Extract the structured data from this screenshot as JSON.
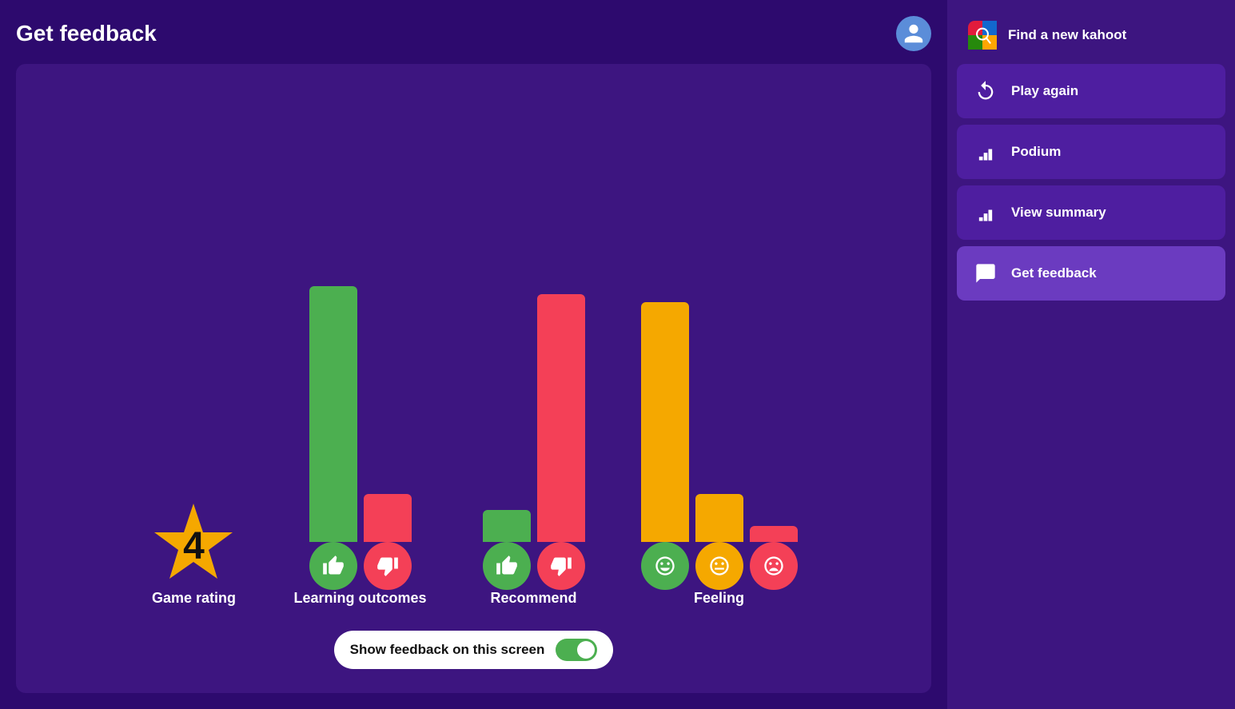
{
  "page": {
    "title": "Get feedback",
    "avatar_label": "user avatar"
  },
  "chart": {
    "game_rating": {
      "value": "4",
      "label": "Game rating"
    },
    "learning_outcomes": {
      "label": "Learning outcomes",
      "bar_height_yes": 320,
      "bar_height_no": 60,
      "bar_color_yes": "#4caf50",
      "bar_color_no": "#f44057"
    },
    "recommend": {
      "label": "Recommend",
      "bar_height_yes": 40,
      "bar_height_no": 310,
      "bar_color_yes": "#4caf50",
      "bar_color_no": "#f44057"
    },
    "feeling": {
      "label": "Feeling",
      "bar_height_happy": 300,
      "bar_height_neutral": 60,
      "bar_height_sad": 20,
      "bar_color_happy": "#f5a800",
      "bar_color_neutral": "#f5a800",
      "bar_color_sad": "#f44057"
    }
  },
  "toggle": {
    "label": "Show feedback on this screen",
    "enabled": true
  },
  "sidebar": {
    "items": [
      {
        "id": "find-kahoot",
        "label": "Find a new kahoot",
        "icon": "search-kahoot-icon",
        "active": false
      },
      {
        "id": "play-again",
        "label": "Play again",
        "icon": "play-again-icon",
        "active": false
      },
      {
        "id": "podium",
        "label": "Podium",
        "icon": "podium-icon",
        "active": false
      },
      {
        "id": "view-summary",
        "label": "View summary",
        "icon": "summary-icon",
        "active": false
      },
      {
        "id": "get-feedback",
        "label": "Get feedback",
        "icon": "feedback-icon",
        "active": true
      }
    ]
  }
}
